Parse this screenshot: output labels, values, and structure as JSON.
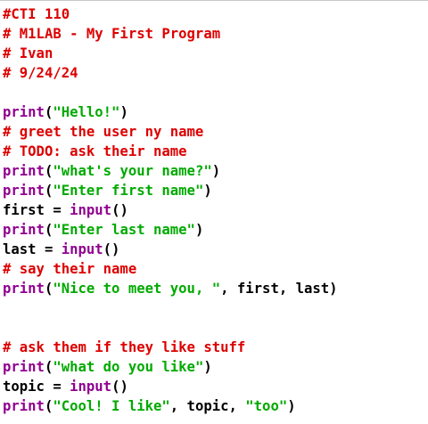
{
  "editor": {
    "lines": [
      {
        "parts": [
          {
            "type": "comment",
            "text": "#CTI 110"
          }
        ]
      },
      {
        "parts": [
          {
            "type": "comment",
            "text": "# M1LAB - My First Program"
          }
        ]
      },
      {
        "parts": [
          {
            "type": "comment",
            "text": "# Ivan"
          }
        ]
      },
      {
        "parts": [
          {
            "type": "comment",
            "text": "# 9/24/24"
          }
        ]
      },
      {
        "parts": []
      },
      {
        "parts": [
          {
            "type": "builtin",
            "text": "print"
          },
          {
            "type": "plain",
            "text": "("
          },
          {
            "type": "string",
            "text": "\"Hello!\""
          },
          {
            "type": "plain",
            "text": ")"
          }
        ]
      },
      {
        "parts": [
          {
            "type": "comment",
            "text": "# greet the user ny name"
          }
        ]
      },
      {
        "parts": [
          {
            "type": "comment",
            "text": "# TODO: ask their name"
          }
        ]
      },
      {
        "parts": [
          {
            "type": "builtin",
            "text": "print"
          },
          {
            "type": "plain",
            "text": "("
          },
          {
            "type": "string",
            "text": "\"what's your name?\""
          },
          {
            "type": "plain",
            "text": ")"
          }
        ]
      },
      {
        "parts": [
          {
            "type": "builtin",
            "text": "print"
          },
          {
            "type": "plain",
            "text": "("
          },
          {
            "type": "string",
            "text": "\"Enter first name\""
          },
          {
            "type": "plain",
            "text": ")"
          }
        ]
      },
      {
        "parts": [
          {
            "type": "plain",
            "text": "first = "
          },
          {
            "type": "builtin",
            "text": "input"
          },
          {
            "type": "plain",
            "text": "()"
          }
        ]
      },
      {
        "parts": [
          {
            "type": "builtin",
            "text": "print"
          },
          {
            "type": "plain",
            "text": "("
          },
          {
            "type": "string",
            "text": "\"Enter last name\""
          },
          {
            "type": "plain",
            "text": ")"
          }
        ]
      },
      {
        "parts": [
          {
            "type": "plain",
            "text": "last = "
          },
          {
            "type": "builtin",
            "text": "input"
          },
          {
            "type": "plain",
            "text": "()"
          }
        ]
      },
      {
        "parts": [
          {
            "type": "comment",
            "text": "# say their name"
          }
        ]
      },
      {
        "parts": [
          {
            "type": "builtin",
            "text": "print"
          },
          {
            "type": "plain",
            "text": "("
          },
          {
            "type": "string",
            "text": "\"Nice to meet you, \""
          },
          {
            "type": "plain",
            "text": ", first, last)"
          }
        ]
      },
      {
        "parts": []
      },
      {
        "parts": []
      },
      {
        "parts": [
          {
            "type": "comment",
            "text": "# ask them if they like stuff"
          }
        ]
      },
      {
        "parts": [
          {
            "type": "builtin",
            "text": "print"
          },
          {
            "type": "plain",
            "text": "("
          },
          {
            "type": "string",
            "text": "\"what do you like\""
          },
          {
            "type": "plain",
            "text": ")"
          }
        ]
      },
      {
        "parts": [
          {
            "type": "plain",
            "text": "topic = "
          },
          {
            "type": "builtin",
            "text": "input"
          },
          {
            "type": "plain",
            "text": "()"
          }
        ]
      },
      {
        "parts": [
          {
            "type": "builtin",
            "text": "print"
          },
          {
            "type": "plain",
            "text": "("
          },
          {
            "type": "string",
            "text": "\"Cool! I like\""
          },
          {
            "type": "plain",
            "text": ", topic, "
          },
          {
            "type": "string",
            "text": "\"too\""
          },
          {
            "type": "plain",
            "text": ")"
          }
        ]
      }
    ]
  },
  "colors": {
    "comment": "#dd0000",
    "builtin": "#900090",
    "string": "#00aa00",
    "plain": "#000000",
    "background": "#ffffff"
  }
}
